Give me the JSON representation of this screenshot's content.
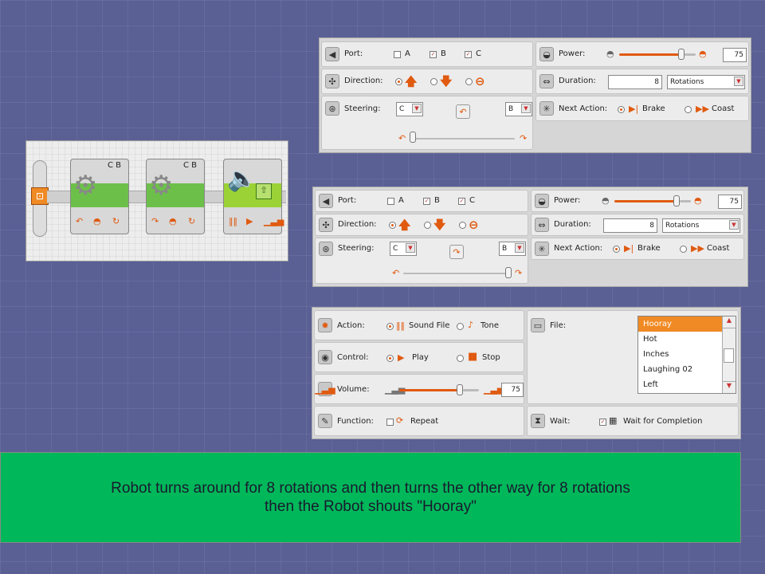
{
  "move_panel_1": {
    "port_label": "Port:",
    "port_a": "A",
    "port_b": "B",
    "port_c": "C",
    "direction_label": "Direction:",
    "steering_label": "Steering:",
    "steer_left_port": "C",
    "steer_right_port": "B",
    "power_label": "Power:",
    "power_value": "75",
    "duration_label": "Duration:",
    "duration_value": "8",
    "duration_unit": "Rotations",
    "next_action_label": "Next Action:",
    "brake_label": "Brake",
    "coast_label": "Coast"
  },
  "move_panel_2": {
    "port_label": "Port:",
    "port_a": "A",
    "port_b": "B",
    "port_c": "C",
    "direction_label": "Direction:",
    "steering_label": "Steering:",
    "steer_left_port": "C",
    "steer_right_port": "B",
    "power_label": "Power:",
    "power_value": "75",
    "duration_label": "Duration:",
    "duration_value": "8",
    "duration_unit": "Rotations",
    "next_action_label": "Next Action:",
    "brake_label": "Brake",
    "coast_label": "Coast"
  },
  "sound_panel": {
    "action_label": "Action:",
    "sound_file_label": "Sound File",
    "tone_label": "Tone",
    "control_label": "Control:",
    "play_label": "Play",
    "stop_label": "Stop",
    "volume_label": "Volume:",
    "volume_value": "75",
    "function_label": "Function:",
    "repeat_label": "Repeat",
    "file_label": "File:",
    "files": [
      "Hooray",
      "Hot",
      "Inches",
      "Laughing 02",
      "Left"
    ],
    "wait_label": "Wait:",
    "wait_for_completion_label": "Wait for Completion"
  },
  "program": {
    "block1_ports": "C B",
    "block2_ports": "C B"
  },
  "caption": {
    "line1": "Robot turns around for 8 rotations and then turns the other way for 8 rotations",
    "line2": "then the Robot shouts \"Hooray\""
  },
  "colors": {
    "accent": "#e05a10",
    "caption_bg": "#00b85a",
    "block_green": "#6cc04a",
    "selected_item": "#f08a24"
  }
}
